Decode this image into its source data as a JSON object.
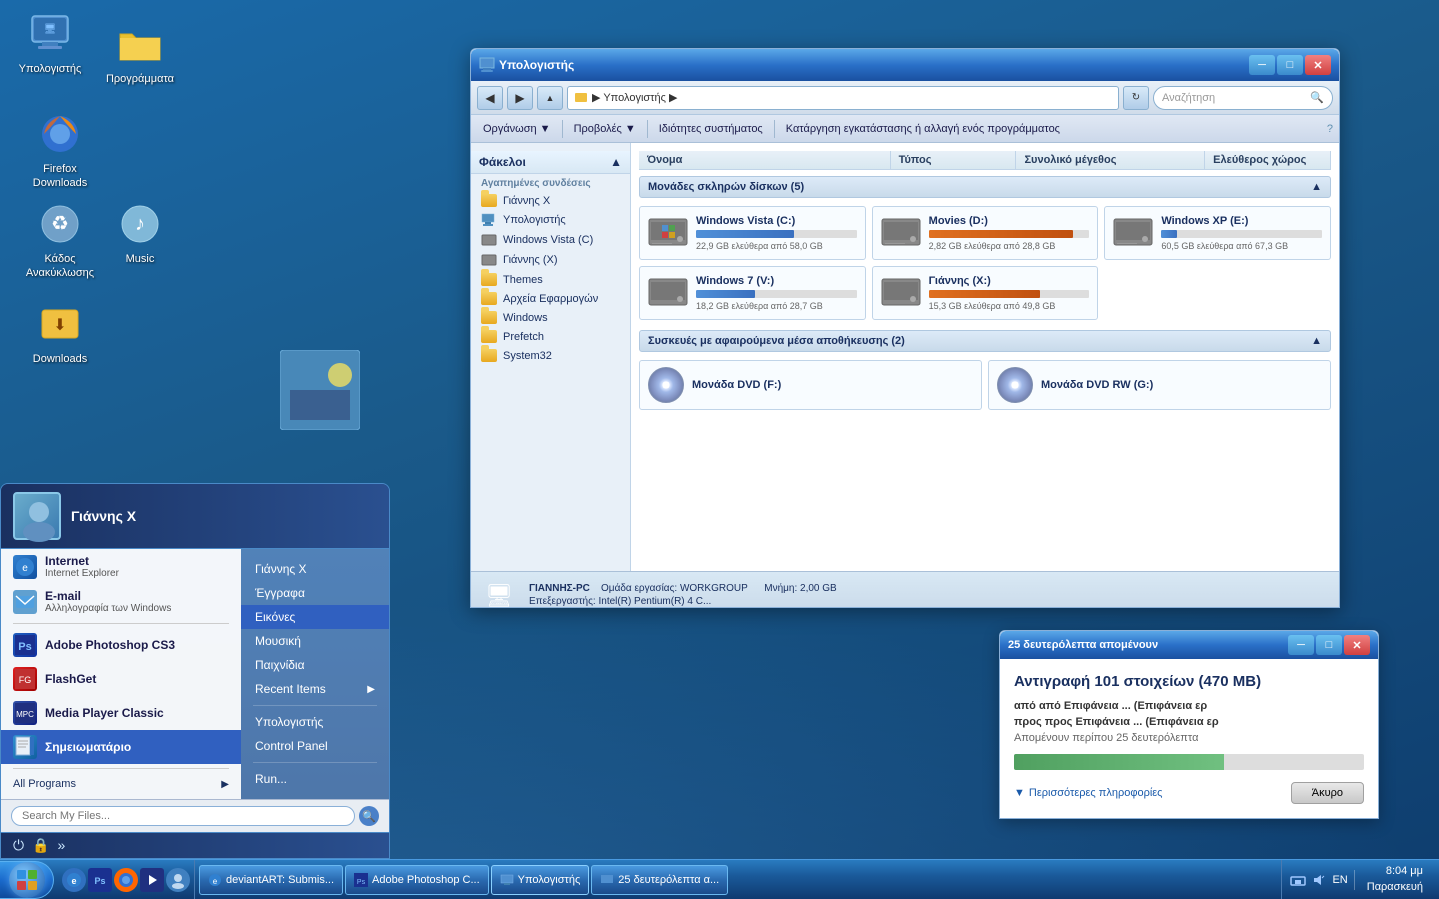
{
  "desktop": {
    "icons": [
      {
        "id": "computer",
        "label": "Υπολογιστής",
        "type": "computer"
      },
      {
        "id": "programs",
        "label": "Προγράμματα",
        "type": "folder"
      },
      {
        "id": "firefox",
        "label": "Firefox\nDownloads",
        "type": "firefox"
      },
      {
        "id": "recycle",
        "label": "Κάδος\nΑνακύκλωσης",
        "type": "recycle"
      },
      {
        "id": "music",
        "label": "Music",
        "type": "music"
      },
      {
        "id": "downloads",
        "label": "Downloads",
        "type": "downloads"
      }
    ]
  },
  "start_menu": {
    "username": "Γιάννης X",
    "left_items": [
      {
        "id": "internet",
        "title": "Internet",
        "sub": "Internet Explorer",
        "icon": "ie"
      },
      {
        "id": "email",
        "title": "E-mail",
        "sub": "Αλληλογραφία των Windows",
        "icon": "mail"
      },
      {
        "id": "photoshop",
        "title": "Adobe Photoshop CS3",
        "sub": "",
        "icon": "ps"
      },
      {
        "id": "flashget",
        "title": "FlashGet",
        "sub": "",
        "icon": "flash"
      },
      {
        "id": "mpc",
        "title": "Media Player Classic",
        "sub": "",
        "icon": "mpc"
      },
      {
        "id": "notepad",
        "title": "Σημειωματάριο",
        "sub": "",
        "icon": "notepad",
        "active": true
      }
    ],
    "right_items": [
      {
        "id": "giannhs",
        "label": "Γιάννης X"
      },
      {
        "id": "documents",
        "label": "Έγγραφα"
      },
      {
        "id": "images",
        "label": "Εικόνες",
        "active": true
      },
      {
        "id": "music",
        "label": "Μουσική"
      },
      {
        "id": "games",
        "label": "Παιχνίδια"
      },
      {
        "id": "recent",
        "label": "Recent Items",
        "has_arrow": true
      },
      {
        "id": "computer2",
        "label": "Υπολογιστής"
      },
      {
        "id": "control",
        "label": "Control Panel"
      },
      {
        "id": "run",
        "label": "Run..."
      }
    ],
    "all_programs": "All Programs",
    "search_placeholder": "Search My Files...",
    "bottom": {
      "icons": [
        "power",
        "lock",
        "arrow"
      ]
    }
  },
  "explorer": {
    "title": "Υπολογιστής",
    "address": "▶ Υπολογιστής ▶",
    "search_placeholder": "Αναζήτηση",
    "toolbar": {
      "organize": "Οργάνωση",
      "views": "Προβολές",
      "properties": "Ιδιότητες συστήματος",
      "uninstall": "Κατάργηση εγκατάστασης ή αλλαγή ενός προγράμματος"
    },
    "columns": {
      "name": "Όνομα",
      "type": "Τύπος",
      "total": "Συνολικό μέγεθος",
      "free": "Ελεύθερος χώρος"
    },
    "sidebar": {
      "favorites_title": "Αγαπημένες συνδέσεις",
      "items": [
        {
          "label": "Γιάννης X"
        },
        {
          "label": "Υπολογιστής"
        },
        {
          "label": "Windows Vista (C)"
        },
        {
          "label": "Γιάννης (X)"
        },
        {
          "label": "Themes"
        },
        {
          "label": "Αρχεία Εφαρμογών"
        },
        {
          "label": "Windows"
        },
        {
          "label": "Prefetch"
        },
        {
          "label": "System32"
        }
      ]
    },
    "sections": {
      "hard_drives": "Μονάδες σκληρών δίσκων (5)",
      "removable": "Συσκευές με αφαιρούμενα μέσα αποθήκευσης (2)"
    },
    "drives": [
      {
        "name": "Windows Vista (C:)",
        "free": "22,9 GB ελεύθερα από 58,0 GB",
        "bar": 61,
        "warning": false
      },
      {
        "name": "Movies (D:)",
        "free": "2,82 GB ελεύθερα από 28,8 GB",
        "bar": 90,
        "warning": true
      },
      {
        "name": "Windows XP (E:)",
        "free": "60,5 GB ελεύθερα από 67,3 GB",
        "bar": 10,
        "warning": false
      },
      {
        "name": "Windows 7 (V:)",
        "free": "18,2 GB ελεύθερα από 28,7 GB",
        "bar": 37,
        "warning": false
      },
      {
        "name": "Γιάννης (X:)",
        "free": "15,3 GB ελεύθερα από 49,8 GB",
        "bar": 69,
        "warning": true
      }
    ],
    "dvd_drives": [
      {
        "name": "Μονάδα DVD (F:)"
      },
      {
        "name": "Μονάδα DVD RW (G:)"
      }
    ],
    "status": {
      "computer": "ΓΙΑΝΝΗΣ-PC",
      "workgroup": "Ομάδα εργασίας: WORKGROUP",
      "memory": "Μνήμη: 2,00 GB",
      "processor": "Επεξεργαστής: Intel(R) Pentium(R) 4 C..."
    }
  },
  "copy_dialog": {
    "title": "25 δευτερόλεπτα απομένουν",
    "heading": "Αντιγραφή 101 στοιχείων (470 MB)",
    "from": "από Επιφάνεια ... (Επιφάνεια ερ",
    "to": "προς Επιφάνεια ... (Επιφάνεια ερ",
    "time_left": "Απομένουν περίπου 25 δευτερόλεπτα",
    "progress_pct": 60,
    "more_info": "Περισσότερες πληροφορίες",
    "cancel": "Άκυρο"
  },
  "taskbar": {
    "tasks": [
      {
        "label": "deviantART: Submis...",
        "icon": "ie"
      },
      {
        "label": "Adobe Photoshop C...",
        "icon": "ps"
      },
      {
        "label": "Υπολογιστής",
        "icon": "explorer",
        "active": true
      },
      {
        "label": "25 δευτερόλεπτα α...",
        "icon": "copy"
      }
    ],
    "tray": {
      "language": "EN",
      "time": "8:04 μμ",
      "date": "Παρασκευή"
    }
  },
  "icons": {
    "back": "◀",
    "forward": "▶",
    "up": "▲",
    "folder": "📁",
    "search": "🔍",
    "arrow_right": "▶",
    "chevron_down": "▼",
    "windows_logo": "⊞",
    "power": "⏻",
    "lock": "🔒",
    "expand": "»"
  }
}
